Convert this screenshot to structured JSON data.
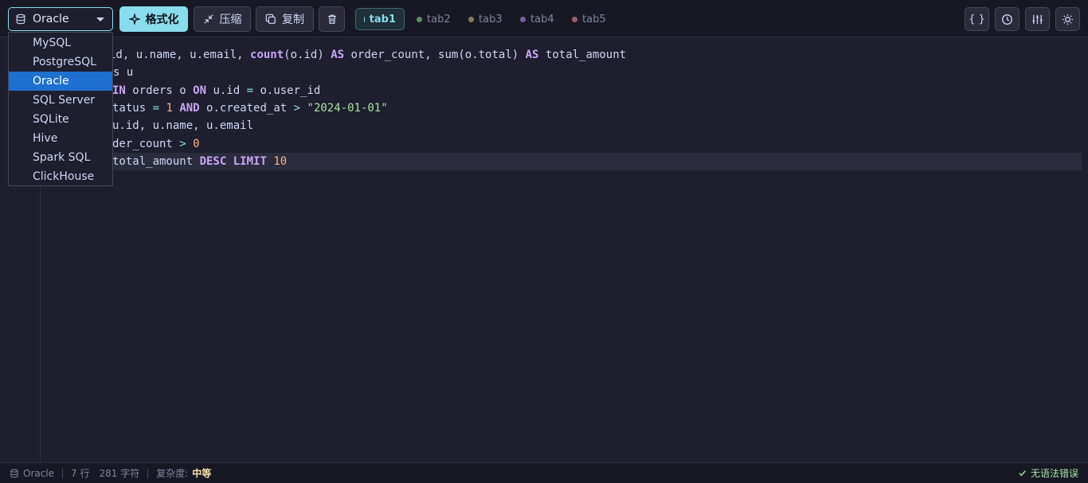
{
  "toolbar": {
    "dialect_selected": "Oracle",
    "format_label": "格式化",
    "compress_label": "压缩",
    "copy_label": "复制",
    "tabs": [
      {
        "label": "tab1",
        "color": "#89dceb",
        "active": true
      },
      {
        "label": "tab2",
        "color": "#5f8a63",
        "active": false
      },
      {
        "label": "tab3",
        "color": "#8a7a5f",
        "active": false
      },
      {
        "label": "tab4",
        "color": "#7a5f9a",
        "active": false
      },
      {
        "label": "tab5",
        "color": "#9a5f6a",
        "active": false
      }
    ],
    "icons": [
      "braces-icon",
      "history-icon",
      "sliders-icon",
      "sun-icon"
    ],
    "braces_label": "{ }"
  },
  "dropdown": {
    "options": [
      "MySQL",
      "PostgreSQL",
      "Oracle",
      "SQL Server",
      "SQLite",
      "Hive",
      "Spark SQL",
      "ClickHouse"
    ],
    "selected": "Oracle"
  },
  "editor": {
    "lines": [
      [
        [
          "",
          "id, u.name, u.email, "
        ],
        [
          "fn",
          "count"
        ],
        [
          "",
          "(o.id) "
        ],
        [
          "kw",
          "AS"
        ],
        [
          "",
          " order_count, sum(o.total) "
        ],
        [
          "kw",
          "AS"
        ],
        [
          "",
          " total_amount"
        ]
      ],
      [
        [
          "",
          "s u"
        ]
      ],
      [
        [
          "kw",
          "IN"
        ],
        [
          "",
          " orders o "
        ],
        [
          "kw",
          "ON"
        ],
        [
          "",
          " u.id "
        ],
        [
          "op",
          "="
        ],
        [
          "",
          " o.user_id"
        ]
      ],
      [
        [
          "",
          "tatus "
        ],
        [
          "op",
          "="
        ],
        [
          "",
          " "
        ],
        [
          "num",
          "1"
        ],
        [
          "",
          " "
        ],
        [
          "kw",
          "AND"
        ],
        [
          "",
          " o.created_at "
        ],
        [
          "op",
          ">"
        ],
        [
          "",
          " "
        ],
        [
          "str",
          "\"2024-01-01\""
        ]
      ],
      [
        [
          "",
          "u.id, u.name, u.email"
        ]
      ],
      [
        [
          "",
          "der_count "
        ],
        [
          "op",
          ">"
        ],
        [
          "",
          " "
        ],
        [
          "num",
          "0"
        ]
      ],
      [
        [
          "",
          "total_amount "
        ],
        [
          "kw",
          "DESC"
        ],
        [
          "",
          " "
        ],
        [
          "kw",
          "LIMIT"
        ],
        [
          "",
          " "
        ],
        [
          "num",
          "10"
        ]
      ]
    ],
    "line_starts": [
      137,
      142,
      141,
      141,
      141,
      141,
      141
    ]
  },
  "status": {
    "dialect": "Oracle",
    "lines": "7 行",
    "chars": "281 字符",
    "complexity_label": "复杂度:",
    "complexity_value": "中等",
    "syntax_status": "无语法错误"
  }
}
